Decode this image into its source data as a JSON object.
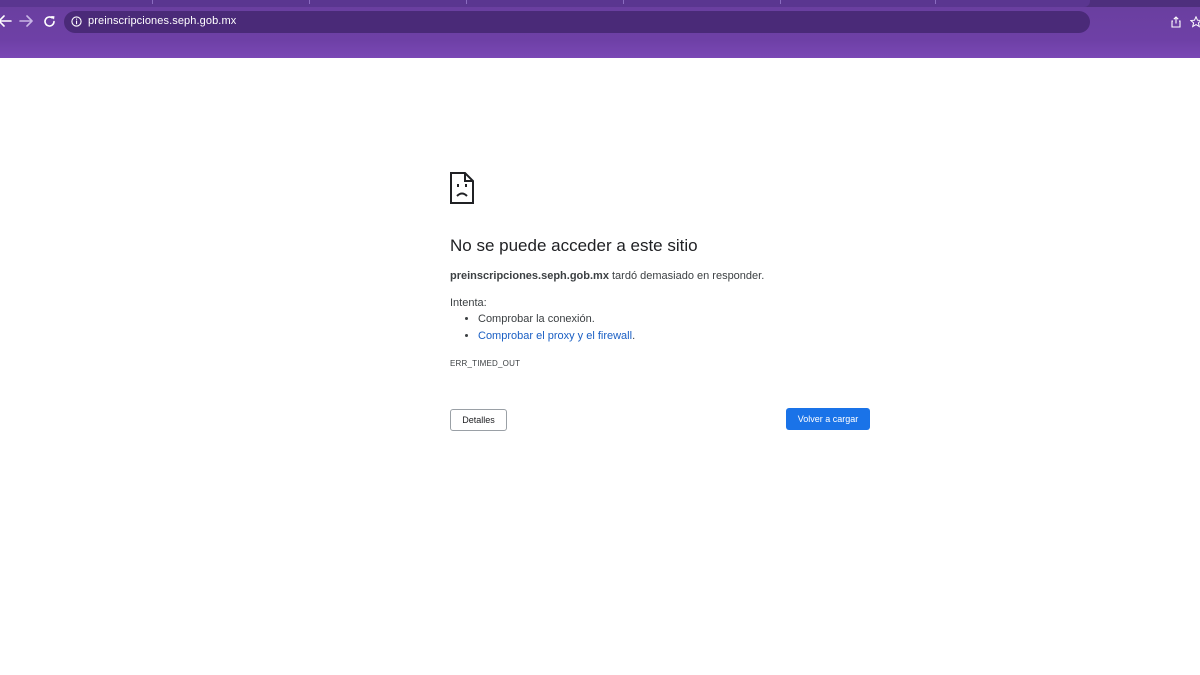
{
  "browser": {
    "url": "preinscripciones.seph.gob.mx",
    "icons": {
      "back": "arrow-left-icon",
      "forward": "arrow-right-icon",
      "reload": "reload-icon",
      "site_info": "info-icon",
      "share": "share-icon",
      "bookmark": "star-icon"
    }
  },
  "error_page": {
    "icon": "sad-document-icon",
    "title": "No se puede acceder a este sitio",
    "host": "preinscripciones.seph.gob.mx",
    "message": " tardó demasiado en responder.",
    "try_label": "Intenta:",
    "suggestions": [
      {
        "text": "Comprobar la conexión.",
        "link": false
      },
      {
        "text": "Comprobar el proxy y el firewall",
        "suffix": ".",
        "link": true
      }
    ],
    "error_code": "ERR_TIMED_OUT",
    "details_button": "Detalles",
    "reload_button": "Volver a cargar"
  },
  "colors": {
    "chrome": "#6e40a6",
    "omnibox": "#4a2a78",
    "reload_button": "#1a73e8",
    "link": "#1a5fc4"
  }
}
